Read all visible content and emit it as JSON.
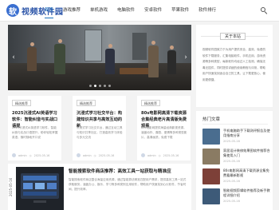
{
  "site": {
    "logo_mark": "软",
    "name": "视频软件园"
  },
  "nav": {
    "items": [
      {
        "label": "首页",
        "active": true
      },
      {
        "label": "游戏推荐"
      },
      {
        "label": "单机游戏"
      },
      {
        "label": "电脑软件"
      },
      {
        "label": "安卓软件"
      },
      {
        "label": "苹果软件"
      },
      {
        "label": "软件排行"
      }
    ]
  },
  "slider": {
    "prev": "‹",
    "next": "›",
    "dots": 5,
    "active_dot": 1
  },
  "about": {
    "title": "关于本站",
    "text": "视频软件园致力于为用户提供安全、高效、免费的软件下载服务，汇集电脑软件、手机应用、游戏资源等多种类型，每款软件均经过人工检测，确保无毒无插件，同时提供详细的使用教程与评测，帮助用户快速找到适合自己的工具，让下载更放心、使用更便捷。"
  },
  "hot": {
    "title": "热门文章",
    "items": [
      {
        "title": "手机电脑助手下载测评报告及使用指南分享",
        "date": "2025-05-16",
        "color": "#4a6d8f"
      },
      {
        "title": "家居设计装修效果图软件推荐合集使用入门",
        "date": "2025-05-16",
        "color": "#8a7b63"
      },
      {
        "title": "80s电影网高清下载资源全集免费看最新影视",
        "date": "2025-05-16",
        "color": "#7d4038"
      },
      {
        "title": "智能视频剪辑软件推荐及新手教程详细介绍",
        "date": "2025-05-16",
        "color": "#3d5a78"
      }
    ]
  },
  "cards": [
    {
      "tag": "精选推荐",
      "title": "2025沉浸式AI英语学习软件：智能纠音与实战口语提",
      "desc": "2025沉浸式AI英语学习软件，智能纠音与实战口语提升，助你轻松掌握英语，随时随地开口说",
      "author": "admin",
      "date": "2025-05-16"
    },
    {
      "tag": "精选推荐",
      "title": "沉浸式学习社交平台：构建知识共享与高效互动的新",
      "desc": "沉浸式学习社交平台，通过互动工具与知识共享社区，打造高效学习体验与多元交流",
      "author": "admin",
      "date": "2025-05-16"
    },
    {
      "tag": "精选推荐",
      "title": "80s电影网高清下载资源合集经典老片高清版免费观看",
      "desc": "80s电影网提供海量经典影视资源，涵盖动作、喜剧、爱情等多种类型影片，高清画质，免费下载",
      "author": "admin",
      "date": "2025-05-16"
    }
  ],
  "article": {
    "date": "2025-05-16",
    "title": "智能搜索软件商店推荐：高效工具一站获取与精准应",
    "desc": "智能搜索软件商店整合海量应用资源，通过智能算法精准匹配用户需求，提供高效工具一站式获取服务，涵盖办公、娱乐、学习等多种类别应用软件，帮助用户快速找到心仪软件，节省时间，提升效率。"
  }
}
